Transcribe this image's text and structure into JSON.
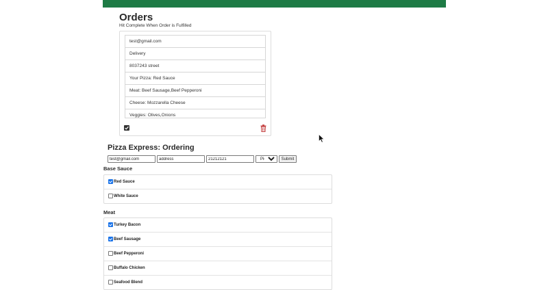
{
  "colors": {
    "header_bar": "#1e7b45",
    "checkbox_checked": "#1a73e8",
    "trash": "#c23b3b"
  },
  "orders": {
    "title": "Orders",
    "subtitle": "Hit Complete When Order is Fulfilled",
    "lines": [
      "test@gmail.com",
      "Delivery",
      "8037243 street",
      "Your Pizza: Red Sauce",
      "Meat: Beef Sausage,Beef Pepperoni",
      "Cheese: Mozzarella Cheese",
      "Veggies: Olives,Onions"
    ],
    "icons": {
      "complete": "checkbox-checked-icon",
      "delete": "trash-icon"
    }
  },
  "ordering": {
    "title": "Pizza Express: Ordering",
    "email_value": "test@gmail.com",
    "address_value": "address",
    "phone_value": "21212121",
    "method_value": "Pick Up",
    "submit_label": "Submit"
  },
  "base_sauce": {
    "heading": "Base Sauce",
    "options": [
      {
        "label": "Red Sauce",
        "checked": true
      },
      {
        "label": "White Sauce",
        "checked": false
      }
    ]
  },
  "meat": {
    "heading": "Meat",
    "options": [
      {
        "label": "Turkey Bacon",
        "checked": true
      },
      {
        "label": "Beef Sausage",
        "checked": true
      },
      {
        "label": "Beef Pepperoni",
        "checked": false
      },
      {
        "label": "Buffalo Chicken",
        "checked": false
      },
      {
        "label": "Seafood Blend",
        "checked": false
      }
    ]
  }
}
